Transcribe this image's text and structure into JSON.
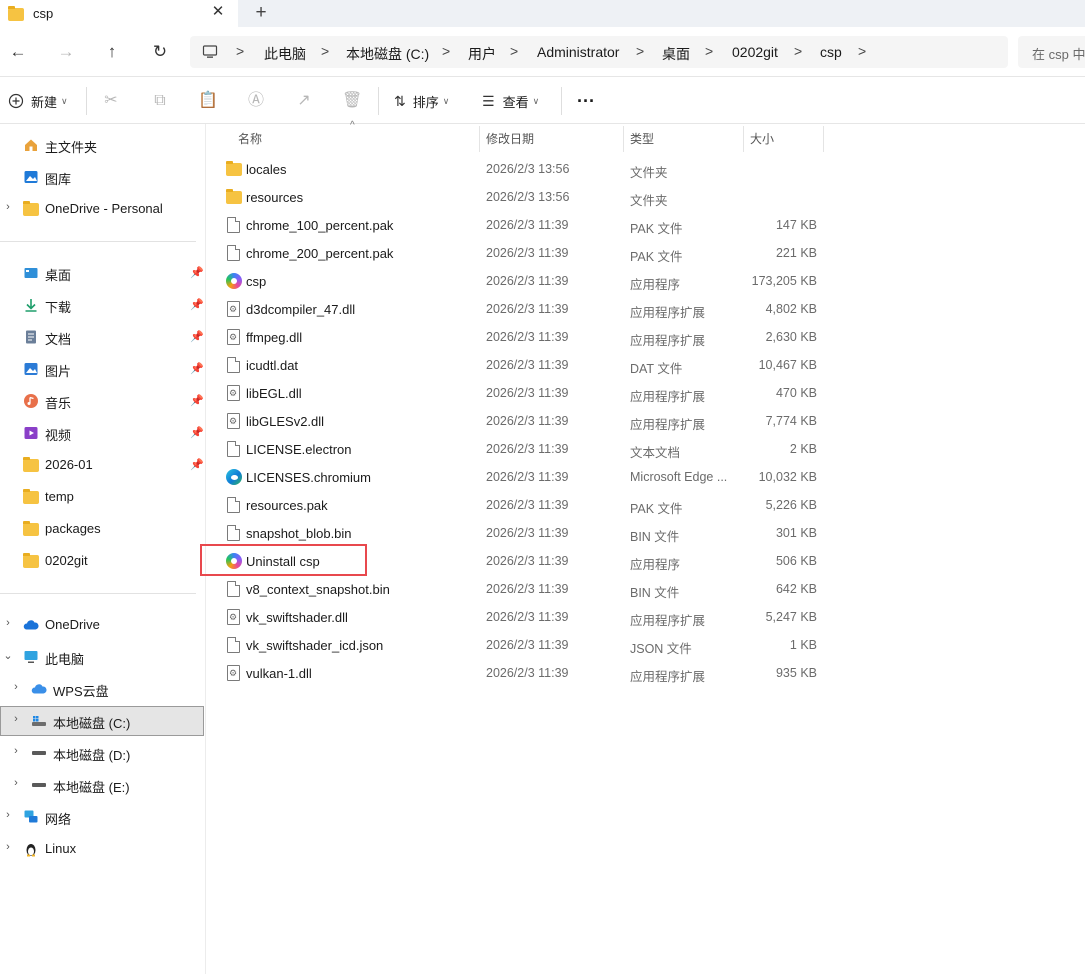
{
  "tab": {
    "title": "csp",
    "close": "✕",
    "new": "+"
  },
  "nav": {
    "back": "←",
    "forward": "→",
    "up": "↑",
    "refresh": "↻"
  },
  "breadcrumb": [
    "此电脑",
    "本地磁盘 (C:)",
    "用户",
    "Administrator",
    "桌面",
    "0202git",
    "csp"
  ],
  "breadcrumb_sep": ">",
  "search": {
    "placeholder": "在 csp 中"
  },
  "toolbar": {
    "new_label": "新建",
    "sort_label": "排序",
    "view_label": "查看",
    "more": "···"
  },
  "sidebar": {
    "quick": [
      {
        "label": "主文件夹",
        "icon": "home-icon"
      },
      {
        "label": "图库",
        "icon": "gallery-icon"
      },
      {
        "label": "OneDrive - Personal",
        "icon": "folder-icon"
      }
    ],
    "pinned": [
      {
        "label": "桌面",
        "icon": "desktop-icon"
      },
      {
        "label": "下载",
        "icon": "download-icon"
      },
      {
        "label": "文档",
        "icon": "documents-icon"
      },
      {
        "label": "图片",
        "icon": "pictures-icon"
      },
      {
        "label": "音乐",
        "icon": "music-icon"
      },
      {
        "label": "视频",
        "icon": "videos-icon"
      },
      {
        "label": "2026-01",
        "icon": "folder-icon"
      },
      {
        "label": "temp",
        "icon": "folder-icon"
      },
      {
        "label": "packages",
        "icon": "folder-icon"
      },
      {
        "label": "0202git",
        "icon": "folder-icon"
      }
    ],
    "tree": [
      {
        "label": "OneDrive",
        "icon": "onedrive-icon"
      },
      {
        "label": "此电脑",
        "icon": "pc-icon"
      },
      {
        "label": "WPS云盘",
        "icon": "cloud-icon"
      },
      {
        "label": "本地磁盘 (C:)",
        "icon": "drive-icon"
      },
      {
        "label": "本地磁盘 (D:)",
        "icon": "drive-icon"
      },
      {
        "label": "本地磁盘 (E:)",
        "icon": "drive-icon"
      },
      {
        "label": "网络",
        "icon": "network-icon"
      },
      {
        "label": "Linux",
        "icon": "linux-icon"
      }
    ]
  },
  "columns": {
    "name": "名称",
    "date": "修改日期",
    "type": "类型",
    "size": "大小"
  },
  "files": [
    {
      "name": "locales",
      "date": "2026/2/3 13:56",
      "type": "文件夹",
      "size": "",
      "icon": "folder"
    },
    {
      "name": "resources",
      "date": "2026/2/3 13:56",
      "type": "文件夹",
      "size": "",
      "icon": "folder"
    },
    {
      "name": "chrome_100_percent.pak",
      "date": "2026/2/3 11:39",
      "type": "PAK 文件",
      "size": "147 KB",
      "icon": "file"
    },
    {
      "name": "chrome_200_percent.pak",
      "date": "2026/2/3 11:39",
      "type": "PAK 文件",
      "size": "221 KB",
      "icon": "file"
    },
    {
      "name": "csp",
      "date": "2026/2/3 11:39",
      "type": "应用程序",
      "size": "173,205 KB",
      "icon": "app"
    },
    {
      "name": "d3dcompiler_47.dll",
      "date": "2026/2/3 11:39",
      "type": "应用程序扩展",
      "size": "4,802 KB",
      "icon": "gear"
    },
    {
      "name": "ffmpeg.dll",
      "date": "2026/2/3 11:39",
      "type": "应用程序扩展",
      "size": "2,630 KB",
      "icon": "gear"
    },
    {
      "name": "icudtl.dat",
      "date": "2026/2/3 11:39",
      "type": "DAT 文件",
      "size": "10,467 KB",
      "icon": "file"
    },
    {
      "name": "libEGL.dll",
      "date": "2026/2/3 11:39",
      "type": "应用程序扩展",
      "size": "470 KB",
      "icon": "gear"
    },
    {
      "name": "libGLESv2.dll",
      "date": "2026/2/3 11:39",
      "type": "应用程序扩展",
      "size": "7,774 KB",
      "icon": "gear"
    },
    {
      "name": "LICENSE.electron",
      "date": "2026/2/3 11:39",
      "type": "文本文档",
      "size": "2 KB",
      "icon": "file"
    },
    {
      "name": "LICENSES.chromium",
      "date": "2026/2/3 11:39",
      "type": "Microsoft Edge ...",
      "size": "10,032 KB",
      "icon": "edge"
    },
    {
      "name": "resources.pak",
      "date": "2026/2/3 11:39",
      "type": "PAK 文件",
      "size": "5,226 KB",
      "icon": "file"
    },
    {
      "name": "snapshot_blob.bin",
      "date": "2026/2/3 11:39",
      "type": "BIN 文件",
      "size": "301 KB",
      "icon": "file"
    },
    {
      "name": "Uninstall csp",
      "date": "2026/2/3 11:39",
      "type": "应用程序",
      "size": "506 KB",
      "icon": "app"
    },
    {
      "name": "v8_context_snapshot.bin",
      "date": "2026/2/3 11:39",
      "type": "BIN 文件",
      "size": "642 KB",
      "icon": "file"
    },
    {
      "name": "vk_swiftshader.dll",
      "date": "2026/2/3 11:39",
      "type": "应用程序扩展",
      "size": "5,247 KB",
      "icon": "gear"
    },
    {
      "name": "vk_swiftshader_icd.json",
      "date": "2026/2/3 11:39",
      "type": "JSON 文件",
      "size": "1 KB",
      "icon": "file"
    },
    {
      "name": "vulkan-1.dll",
      "date": "2026/2/3 11:39",
      "type": "应用程序扩展",
      "size": "935 KB",
      "icon": "gear"
    }
  ],
  "highlighted_file": "Uninstall csp",
  "colors": {
    "highlight": "#e8484d",
    "folder": "#f6c342",
    "selected_bg": "#e5e5e5"
  }
}
